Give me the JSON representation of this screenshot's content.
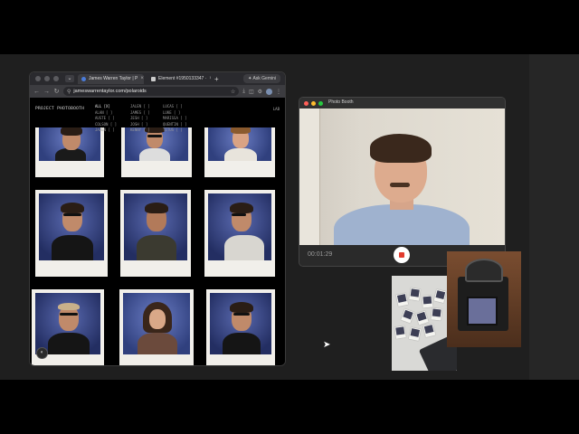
{
  "browser": {
    "tabs": [
      {
        "label": "James Warren Taylor | P",
        "active": true
      },
      {
        "label": "Element #1950133347 ·",
        "active": false
      }
    ],
    "ask_label": "Ask Gemini",
    "url": "jameswarrentaylor.com/polaroids"
  },
  "site": {
    "title": "PROJECT PHOTOBOOTH",
    "filters": [
      {
        "label": "ALL [X]",
        "active": true
      },
      {
        "label": "JALEN [ ]",
        "active": false
      },
      {
        "label": "LUCAS [ ]",
        "active": false
      },
      {
        "label": "ALAN [ ]",
        "active": false
      },
      {
        "label": "JAMES [ ]",
        "active": false
      },
      {
        "label": "LUKE [ ]",
        "active": false
      },
      {
        "label": "AUSTE [ ]",
        "active": false
      },
      {
        "label": "JESH [ ]",
        "active": false
      },
      {
        "label": "MARISSA [ ]",
        "active": false
      },
      {
        "label": "COLSON [ ]",
        "active": false
      },
      {
        "label": "JOSH [ ]",
        "active": false
      },
      {
        "label": "QUENTIN [ ]",
        "active": false
      },
      {
        "label": "JADEN [ ]",
        "active": false
      },
      {
        "label": "KENNY [ ]",
        "active": false
      },
      {
        "label": "TITUS [ ]",
        "active": false
      }
    ],
    "lab_label": "LAB"
  },
  "photobooth": {
    "title": "Photo Booth",
    "timer": "00:01:29",
    "colors": {
      "close": "#ff5f57",
      "minimize": "#febc2e",
      "zoom": "#28c840",
      "record": "#e23b2e"
    }
  }
}
